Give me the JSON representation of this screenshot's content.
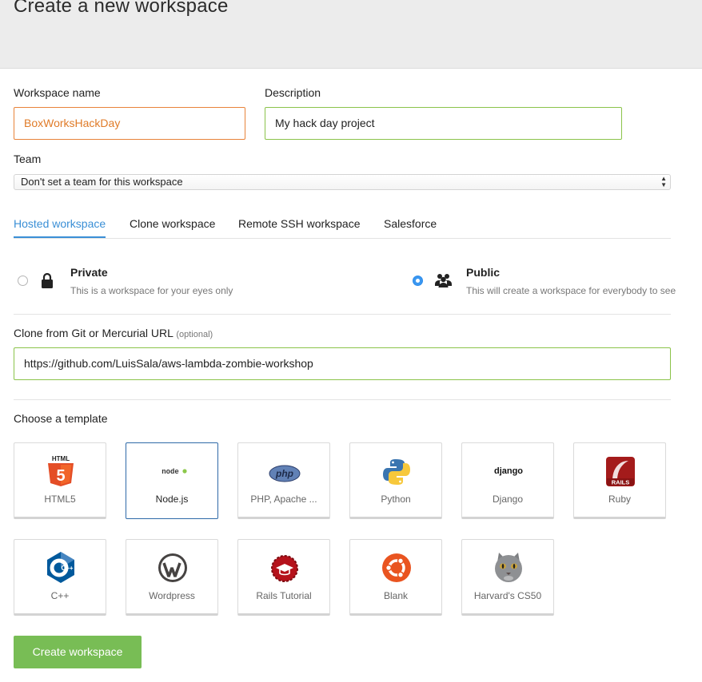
{
  "page": {
    "title": "Create a new workspace"
  },
  "form": {
    "workspace_name_label": "Workspace name",
    "workspace_name_value": "BoxWorksHackDay",
    "description_label": "Description",
    "description_value": "My hack day project",
    "team_label": "Team",
    "team_selected": "Don't set a team for this workspace"
  },
  "tabs": [
    {
      "label": "Hosted workspace",
      "active": true
    },
    {
      "label": "Clone workspace",
      "active": false
    },
    {
      "label": "Remote SSH workspace",
      "active": false
    },
    {
      "label": "Salesforce",
      "active": false
    }
  ],
  "visibility": {
    "private": {
      "title": "Private",
      "desc": "This is a workspace for your eyes only",
      "icon": "lock-icon",
      "checked": false
    },
    "public": {
      "title": "Public",
      "desc": "This will create a workspace for everybody to see",
      "icon": "users-icon",
      "checked": true
    }
  },
  "clone": {
    "label": "Clone from Git or Mercurial URL",
    "optional": "(optional)",
    "value": "https://github.com/LuisSala/aws-lambda-zombie-workshop"
  },
  "templates": {
    "heading": "Choose a template",
    "items": [
      {
        "name": "HTML5",
        "icon": "html5-icon",
        "selected": false
      },
      {
        "name": "Node.js",
        "icon": "nodejs-icon",
        "selected": true
      },
      {
        "name": "PHP, Apache ...",
        "icon": "php-icon",
        "selected": false
      },
      {
        "name": "Python",
        "icon": "python-icon",
        "selected": false
      },
      {
        "name": "Django",
        "icon": "django-icon",
        "selected": false
      },
      {
        "name": "Ruby",
        "icon": "ruby-rails-icon",
        "selected": false
      },
      {
        "name": "C++",
        "icon": "cpp-icon",
        "selected": false
      },
      {
        "name": "Wordpress",
        "icon": "wordpress-icon",
        "selected": false
      },
      {
        "name": "Rails Tutorial",
        "icon": "rails-tutorial-icon",
        "selected": false
      },
      {
        "name": "Blank",
        "icon": "ubuntu-icon",
        "selected": false
      },
      {
        "name": "Harvard's CS50",
        "icon": "cat-icon",
        "selected": false
      }
    ]
  },
  "icon_text": {
    "html5_top": "HTML",
    "html5_num": "5",
    "node": "node",
    "php": "php",
    "django": "django",
    "rails": "RAILS",
    "cpp": "C++"
  },
  "actions": {
    "create_label": "Create workspace"
  },
  "colors": {
    "accent_blue": "#3a8fd6",
    "primary_green": "#78bd55",
    "input_orange": "#e8833a",
    "input_green": "#8bc34a"
  }
}
